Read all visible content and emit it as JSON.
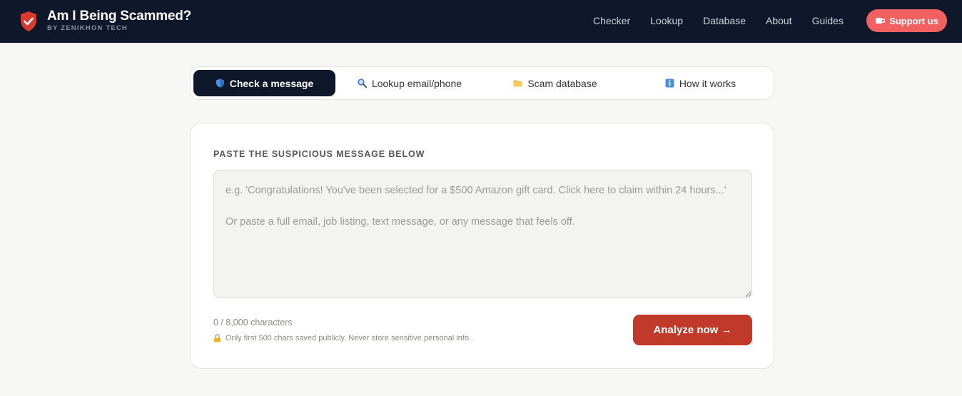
{
  "header": {
    "title": "Am I Being Scammed?",
    "subtitle": "BY ZENIKHON TECH",
    "logo_icon": "shield-check-icon",
    "nav": [
      "Checker",
      "Lookup",
      "Database",
      "About",
      "Guides"
    ],
    "support_label": "Support us",
    "support_icon": "coffee-cup-icon"
  },
  "tabs": [
    {
      "label": "Check a message",
      "icon": "shield-icon",
      "active": true
    },
    {
      "label": "Lookup email/phone",
      "icon": "magnifier-icon",
      "active": false
    },
    {
      "label": "Scam database",
      "icon": "folder-icon",
      "active": false
    },
    {
      "label": "How it works",
      "icon": "info-icon",
      "active": false
    }
  ],
  "checker": {
    "section_label": "PASTE THE SUSPICIOUS MESSAGE BELOW",
    "placeholder": "e.g. 'Congratulations! You've been selected for a $500 Amazon gift card. Click here to claim within 24 hours...'\n\nOr paste a full email, job listing, text message, or any message that feels off.",
    "value": "",
    "char_count": "0 / 8,000 characters",
    "privacy_note": "Only first 500 chars saved publicly. Never store sensitive personal info.",
    "privacy_icon": "lock-icon",
    "analyze_label": "Analyze now →"
  },
  "colors": {
    "header_bg": "#0f172a",
    "support_bg": "#f26161",
    "analyze_bg": "#c0392b",
    "active_tab_bg": "#0f172a",
    "logo_red": "#d93a2e"
  }
}
